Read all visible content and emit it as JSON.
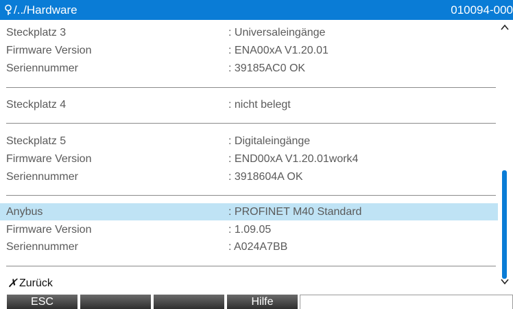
{
  "titlebar": {
    "icon": "search-icon",
    "path": "/../Hardware",
    "code": "010094-000"
  },
  "rows": [
    {
      "label": "Steckplatz 3",
      "value": ": Universaleingänge"
    },
    {
      "label": "Firmware Version",
      "value": ": ENA00xA V1.20.01"
    },
    {
      "label": "Seriennummer",
      "value": ": 39185AC0 OK"
    },
    {
      "label": "Steckplatz 4",
      "value": ": nicht belegt"
    },
    {
      "label": "Steckplatz 5",
      "value": ": Digitaleingänge"
    },
    {
      "label": "Firmware Version",
      "value": ": END00xA V1.20.01work4"
    },
    {
      "label": "Seriennummer",
      "value": ": 3918604A OK"
    },
    {
      "label": "Anybus",
      "value": ": PROFINET M40 Standard"
    },
    {
      "label": "Firmware Version",
      "value": ": 1.09.05"
    },
    {
      "label": "Seriennummer",
      "value": ": A024A7BB"
    }
  ],
  "back": {
    "icon": "x-mark",
    "label": "Zurück"
  },
  "scrollbar": {
    "up_icon": "chevron-up-icon",
    "down_icon": "chevron-down-icon",
    "accent": "#0a7cd6"
  },
  "softkeys": [
    "ESC",
    "",
    "",
    "Hilfe",
    ""
  ],
  "colors": {
    "title_bg": "#0a7cd6",
    "selection_bg": "#bfe3f5"
  }
}
